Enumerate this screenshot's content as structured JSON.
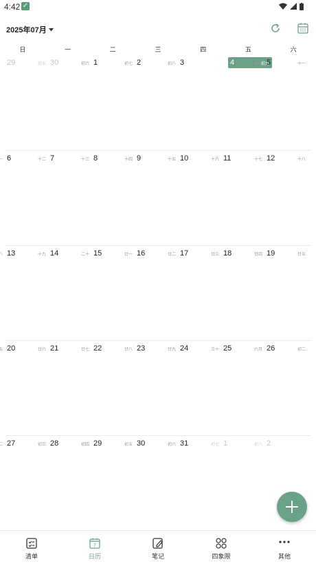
{
  "status": {
    "time": "4:42"
  },
  "header": {
    "month_label": "2025年07月"
  },
  "weekdays": [
    "日",
    "一",
    "二",
    "三",
    "四",
    "五",
    "六"
  ],
  "weeks": [
    [
      {
        "d": "29",
        "l": "",
        "faded": true
      },
      {
        "d": "30",
        "l": "初五",
        "faded": true
      },
      {
        "d": "1",
        "l": "初六"
      },
      {
        "d": "2",
        "l": "初七"
      },
      {
        "d": "3",
        "l": "初八"
      },
      {
        "d": "4",
        "l": "初九",
        "today": true
      },
      {
        "d": "5",
        "l": "初十"
      }
    ],
    [
      {
        "d": "6",
        "l": "十一"
      },
      {
        "d": "7",
        "l": "十二"
      },
      {
        "d": "8",
        "l": "十三"
      },
      {
        "d": "9",
        "l": "十四"
      },
      {
        "d": "10",
        "l": "十五"
      },
      {
        "d": "11",
        "l": "十六"
      },
      {
        "d": "12",
        "l": "十七"
      }
    ],
    [
      {
        "d": "13",
        "l": "十八"
      },
      {
        "d": "14",
        "l": "十九"
      },
      {
        "d": "15",
        "l": "二十"
      },
      {
        "d": "16",
        "l": "廿一"
      },
      {
        "d": "17",
        "l": "廿二"
      },
      {
        "d": "18",
        "l": "廿三"
      },
      {
        "d": "19",
        "l": "廿四"
      }
    ],
    [
      {
        "d": "20",
        "l": "廿五"
      },
      {
        "d": "21",
        "l": "廿六"
      },
      {
        "d": "22",
        "l": "廿七"
      },
      {
        "d": "23",
        "l": "廿八"
      },
      {
        "d": "24",
        "l": "廿九"
      },
      {
        "d": "25",
        "l": "三十"
      },
      {
        "d": "26",
        "l": "六月"
      }
    ],
    [
      {
        "d": "27",
        "l": "初二"
      },
      {
        "d": "28",
        "l": "初三"
      },
      {
        "d": "29",
        "l": "初四"
      },
      {
        "d": "30",
        "l": "初五"
      },
      {
        "d": "31",
        "l": "初六"
      },
      {
        "d": "1",
        "l": "初七",
        "faded": true
      },
      {
        "d": "2",
        "l": "初八",
        "faded": true
      }
    ]
  ],
  "trailing_lunar": [
    "十一",
    "十八",
    "廿五",
    "初二",
    ""
  ],
  "nav": [
    {
      "label": "清单",
      "icon": "checklist-icon"
    },
    {
      "label": "日历",
      "icon": "calendar-icon",
      "active": true
    },
    {
      "label": "笔记",
      "icon": "note-icon"
    },
    {
      "label": "四象限",
      "icon": "quadrant-icon"
    },
    {
      "label": "其他",
      "icon": "more-icon"
    }
  ],
  "colors": {
    "accent": "#6ba287"
  }
}
